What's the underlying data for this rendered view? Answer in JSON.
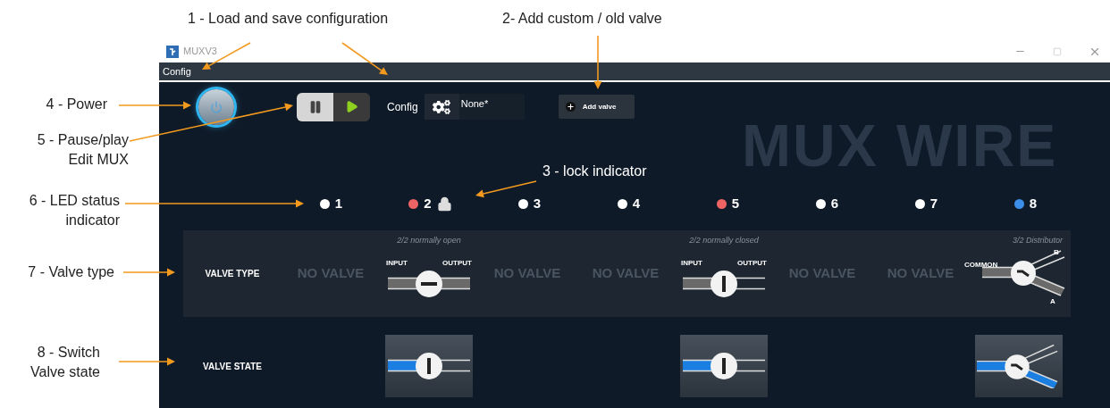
{
  "annotations": [
    {
      "lines": [
        "1 - Load and save configuration"
      ]
    },
    {
      "lines": [
        "2- Add custom / old valve"
      ]
    },
    {
      "lines": [
        "3 - lock indicator"
      ]
    },
    {
      "lines": [
        "4 - Power"
      ]
    },
    {
      "lines": [
        "5 - Pause/play",
        "Edit MUX"
      ]
    },
    {
      "lines": [
        "6 - LED status",
        "indicator"
      ]
    },
    {
      "lines": [
        "7 - Valve type"
      ]
    },
    {
      "lines": [
        "8 - Switch",
        "Valve state"
      ]
    }
  ],
  "window": {
    "title": "MUXV3"
  },
  "menu": [
    {
      "label": "Config"
    }
  ],
  "toolbar": {
    "power": {
      "on": true
    },
    "modes": [
      {
        "kind": "pause",
        "selected": true
      },
      {
        "kind": "play",
        "selected": false
      }
    ],
    "config_label": "Config",
    "config_value": "None*",
    "add_valve": "Add valve"
  },
  "background_text": "MUX WIRE",
  "valve_type_label": "VALVE TYPE",
  "valve_state_label": "VALVE STATE",
  "channels": [
    {
      "number": "1",
      "color": "#ffffff",
      "locked": false,
      "valve": {
        "kind": "none",
        "label": "NO VALVE"
      }
    },
    {
      "number": "2",
      "color": "#ee6464",
      "locked": true,
      "valve": {
        "kind": "normally_open",
        "caption": "2/2 normally open",
        "input": "INPUT",
        "output": "OUTPUT"
      }
    },
    {
      "number": "3",
      "color": "#ffffff",
      "locked": false,
      "valve": {
        "kind": "none",
        "label": "NO VALVE"
      }
    },
    {
      "number": "4",
      "color": "#ffffff",
      "locked": false,
      "valve": {
        "kind": "none",
        "label": "NO VALVE"
      }
    },
    {
      "number": "5",
      "color": "#ee6464",
      "locked": false,
      "valve": {
        "kind": "normally_closed",
        "caption": "2/2 normally closed",
        "input": "INPUT",
        "output": "OUTPUT"
      }
    },
    {
      "number": "6",
      "color": "#ffffff",
      "locked": false,
      "valve": {
        "kind": "none",
        "label": "NO VALVE"
      }
    },
    {
      "number": "7",
      "color": "#ffffff",
      "locked": false,
      "valve": {
        "kind": "none",
        "label": "NO VALVE"
      }
    },
    {
      "number": "8",
      "color": "#3b8fe8",
      "locked": false,
      "valve": {
        "kind": "distributor",
        "caption": "3/2 Distributor",
        "common": "COMMON",
        "port_b": "B",
        "port_a": "A"
      }
    }
  ]
}
